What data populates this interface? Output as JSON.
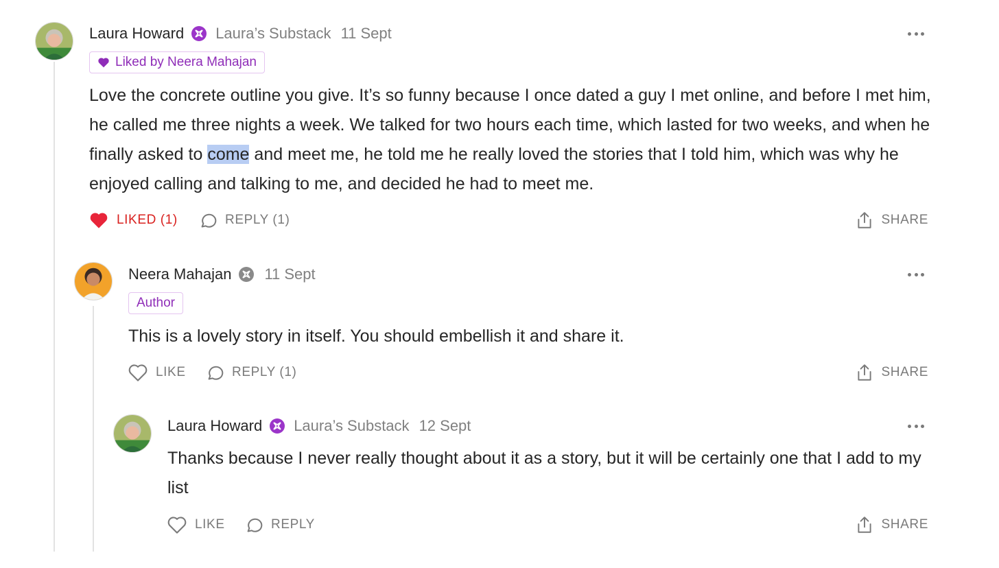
{
  "colors": {
    "accent_purple": "#8f2db8",
    "liked_red": "#d9211f",
    "muted_gray": "#808080",
    "highlight_blue": "#b8cdf3"
  },
  "comments": [
    {
      "author": "Laura Howard",
      "publication": "Laura’s Substack",
      "date": "11 Sept",
      "badge_icon": "substack-badge-icon",
      "tag": "Liked by Neera Mahajan",
      "text_before": "Love the concrete outline you give. It’s so funny because I once dated a guy I met online, and before I met him, he called me three nights a week. We talked for two hours each time, which lasted for two weeks, and when he finally asked to ",
      "text_highlight": "come",
      "text_after": " and meet me, he told me he really loved the stories that I told him, which was why he enjoyed calling and talking to me, and decided he had to meet me.",
      "like_label": "LIKED (1)",
      "liked": true,
      "reply_label": "REPLY (1)",
      "share_label": "SHARE"
    },
    {
      "author": "Neera Mahajan",
      "date": "11 Sept",
      "badge_icon": "substack-badge-icon",
      "tag": "Author",
      "text": "This is a lovely story in itself. You should embellish it and share it.",
      "like_label": "LIKE",
      "liked": false,
      "reply_label": "REPLY (1)",
      "share_label": "SHARE"
    },
    {
      "author": "Laura Howard",
      "publication": "Laura’s Substack",
      "date": "12 Sept",
      "badge_icon": "substack-badge-icon",
      "text": "Thanks because I never really thought about it as a story, but it will be certainly one that I add to my list",
      "like_label": "LIKE",
      "liked": false,
      "reply_label": "REPLY",
      "share_label": "SHARE"
    }
  ]
}
